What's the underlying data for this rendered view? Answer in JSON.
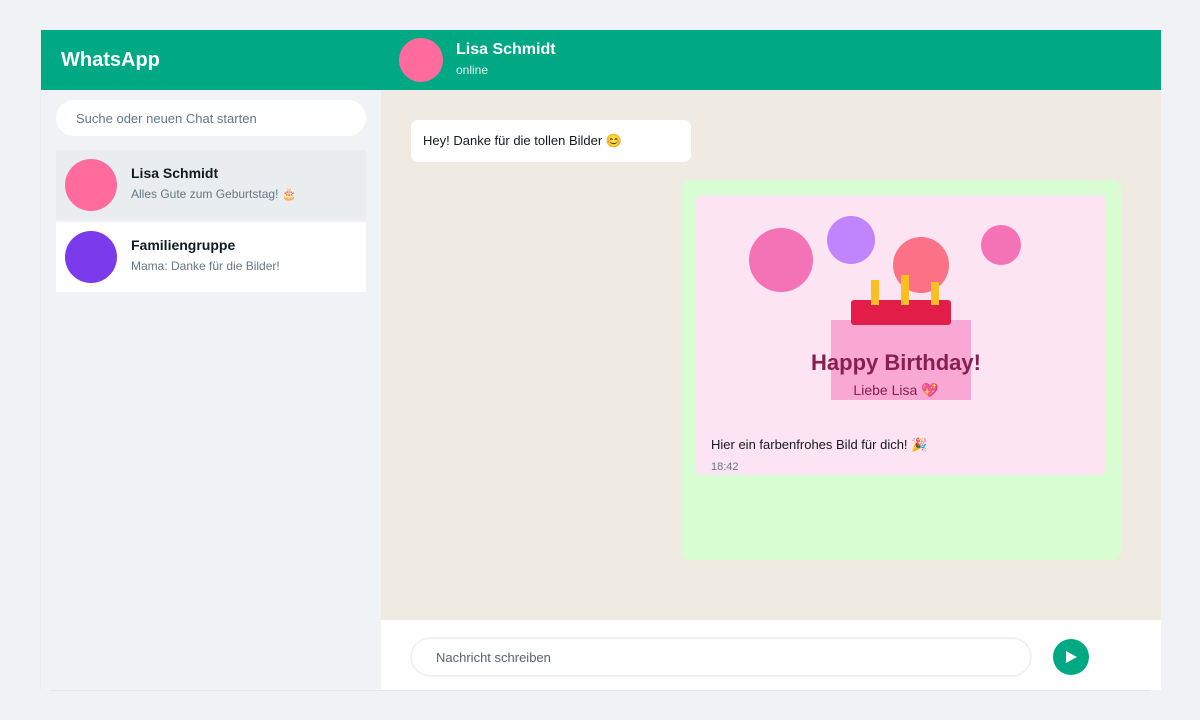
{
  "app": {
    "title": "WhatsApp",
    "colors": {
      "brand": "#00a884",
      "chat_bg": "#efeae2",
      "outgoing_bubble": "#d9fdd3"
    }
  },
  "header": {
    "contact_name": "Lisa Schmidt",
    "contact_status": "online"
  },
  "sidebar": {
    "search_placeholder": "Suche oder neuen Chat starten",
    "chats": [
      {
        "name": "Lisa Schmidt",
        "preview": "Alles Gute zum Geburtstag! 🎂",
        "avatar_color": "#ff6b9d",
        "active": true
      },
      {
        "name": "Familiengruppe",
        "preview": "Mama: Danke für die Bilder!",
        "avatar_color": "#7c3aed",
        "active": false
      }
    ]
  },
  "messages": {
    "incoming": {
      "text": "Hey! Danke für die tollen Bilder 😊"
    },
    "outgoing": {
      "card_title": "Happy Birthday!",
      "card_subtitle": "Liebe Lisa 💖",
      "caption": "Hier ein farbenfrohes Bild für dich! 🎉",
      "time": "18:42"
    }
  },
  "composer": {
    "placeholder": "Nachricht schreiben",
    "send_icon": "send-arrow-icon"
  }
}
